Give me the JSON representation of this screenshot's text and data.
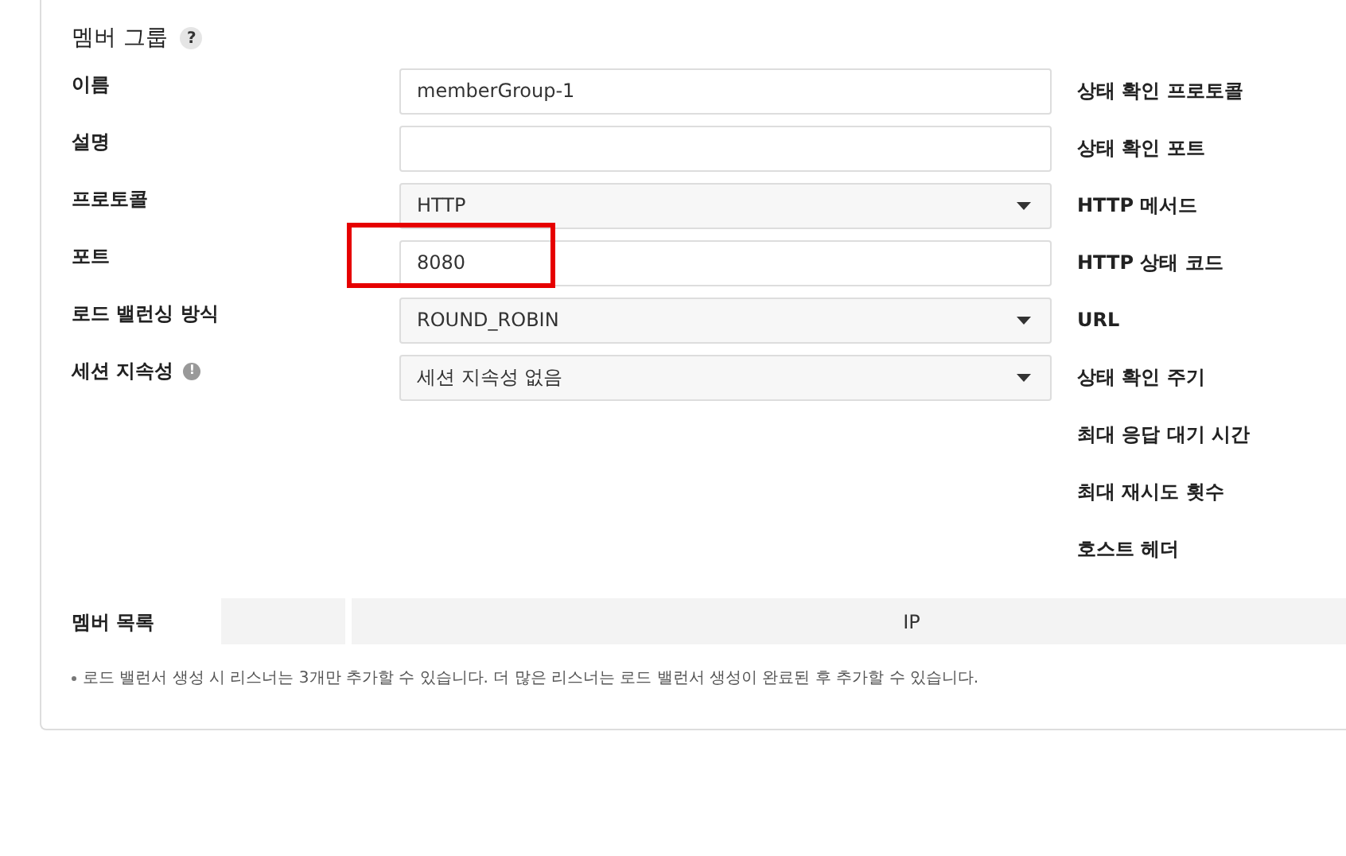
{
  "section": {
    "title": "멤버 그룹",
    "help_icon": "?"
  },
  "fields": [
    {
      "label": "이름",
      "kind": "input",
      "value": "memberGroup-1",
      "highlighted": false
    },
    {
      "label": "설명",
      "kind": "input",
      "highlighted": false
    },
    {
      "label": "프로토콜",
      "kind": "select",
      "value": "HTTP",
      "highlighted": false
    },
    {
      "label": "포트",
      "kind": "input",
      "value": "8080",
      "highlighted": true
    },
    {
      "label": "로드 밸런싱 방식",
      "kind": "select",
      "value": "ROUND_ROBIN",
      "highlighted": false
    },
    {
      "label": "세션 지속성",
      "kind": "select",
      "value": "세션 지속성 없음",
      "info_icon": "!",
      "highlighted": false
    }
  ],
  "health_check_labels": [
    "상태 확인 프로토콜",
    "상태 확인 포트",
    "HTTP 메서드",
    "HTTP 상태 코드",
    "URL",
    "상태 확인 주기",
    "최대 응답 대기 시간",
    "최대 재시도 횟수",
    "호스트 헤더"
  ],
  "member_list": {
    "label": "멤버 목록",
    "columns": [
      "",
      "IP"
    ]
  },
  "note": "로드 밸런서 생성 시 리스너는 3개만 추가할 수 있습니다. 더 많은 리스너는 로드 밸런서 생성이 완료된 후 추가할 수 있습니다."
}
